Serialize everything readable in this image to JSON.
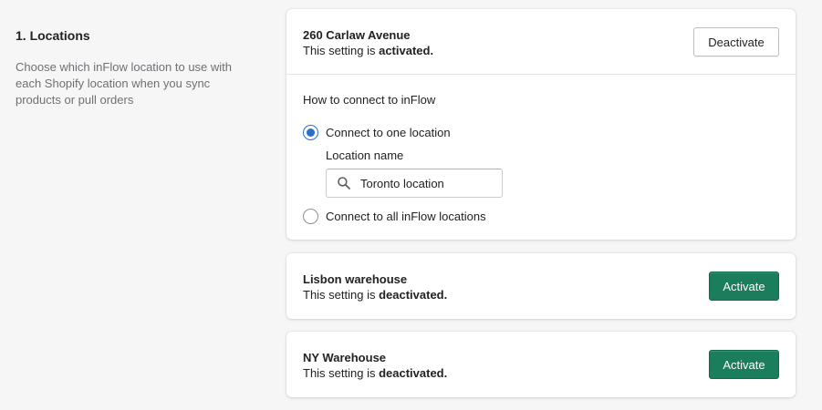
{
  "section": {
    "title": "1. Locations",
    "description": "Choose which inFlow location to use with each Shopify location when you sync products or pull orders"
  },
  "locations": [
    {
      "name": "260 Carlaw Avenue",
      "status_prefix": "This setting is ",
      "status": "activated.",
      "button_label": "Deactivate"
    },
    {
      "name": "Lisbon warehouse",
      "status_prefix": "This setting is ",
      "status": "deactivated.",
      "button_label": "Activate"
    },
    {
      "name": "NY Warehouse",
      "status_prefix": "This setting is ",
      "status": "deactivated.",
      "button_label": "Activate"
    }
  ],
  "connect": {
    "heading": "How to connect to inFlow",
    "option_one": "Connect to one location",
    "option_all": "Connect to all inFlow locations",
    "selected": "one",
    "location_name_label": "Location name",
    "location_name_value": "Toronto location"
  },
  "colors": {
    "primary": "#1a7d5c",
    "radio_selected": "#2c6ecb",
    "background": "#f6f6f7",
    "muted_text": "#6d7175"
  }
}
